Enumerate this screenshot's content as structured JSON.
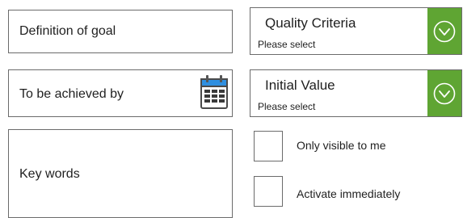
{
  "fields": {
    "goal_label": "Definition of goal",
    "achieved_label": "To be achieved by",
    "keywords_label": "Key words"
  },
  "selects": {
    "quality": {
      "title": "Quality Criteria",
      "placeholder": "Please select"
    },
    "initial": {
      "title": "Initial Value",
      "placeholder": "Please select"
    }
  },
  "checkboxes": {
    "visible_label": "Only visible to me",
    "activate_label": "Activate immediately"
  },
  "icons": {
    "calendar": "calendar-icon",
    "chevron": "chevron-down-circle-icon"
  },
  "colors": {
    "accent_green": "#5fa533",
    "calendar_blue": "#2f8fe0",
    "border": "#6b6b6b"
  }
}
